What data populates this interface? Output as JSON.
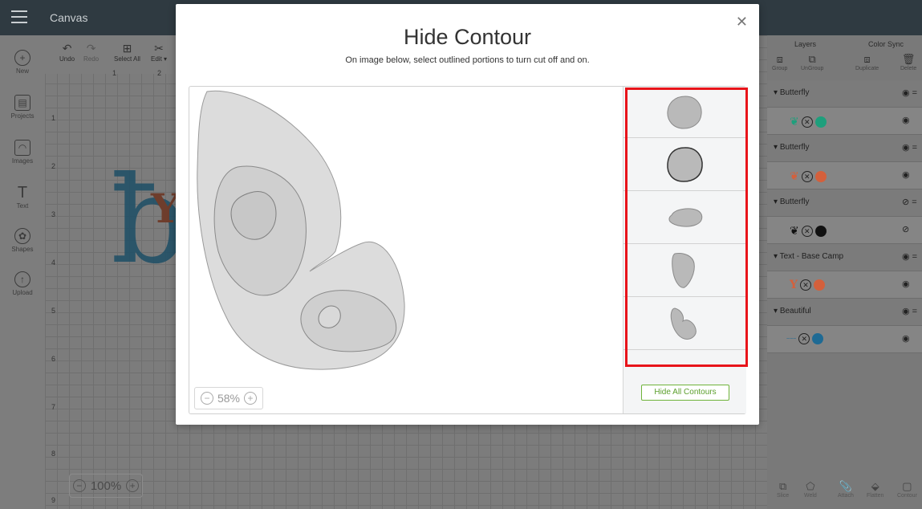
{
  "app": {
    "title": "Canvas"
  },
  "toolbar": {
    "undo": "Undo",
    "redo": "Redo",
    "select_all": "Select All",
    "edit": "Edit ▾"
  },
  "left_rail": [
    {
      "label": "New",
      "icon": "plus-icon"
    },
    {
      "label": "Projects",
      "icon": "projects-icon"
    },
    {
      "label": "Images",
      "icon": "images-icon"
    },
    {
      "label": "Text",
      "icon": "text-icon"
    },
    {
      "label": "Shapes",
      "icon": "shapes-icon"
    },
    {
      "label": "Upload",
      "icon": "upload-icon"
    }
  ],
  "ruler": {
    "horizontal": [
      "1",
      "2"
    ],
    "vertical": [
      "1",
      "2",
      "3",
      "4",
      "5",
      "6",
      "7",
      "8",
      "9"
    ]
  },
  "canvas": {
    "zoom": "100%"
  },
  "right_panel": {
    "tabs": [
      "Layers",
      "Color Sync"
    ],
    "tools": [
      "Group",
      "UnGroup",
      "Duplicate",
      "Delete"
    ],
    "layers": [
      {
        "label": "Butterfly",
        "kind": "group",
        "eye": "visible"
      },
      {
        "label": "",
        "kind": "item",
        "color": "#1e9f7c",
        "eye": "visible"
      },
      {
        "label": "Butterfly",
        "kind": "group",
        "eye": "visible"
      },
      {
        "label": "",
        "kind": "item",
        "color": "#d4603c",
        "eye": "visible"
      },
      {
        "label": "Butterfly",
        "kind": "group",
        "eye": "hidden"
      },
      {
        "label": "",
        "kind": "item",
        "color": "#111111",
        "eye": "hidden"
      },
      {
        "label": "Text - Base Camp",
        "kind": "group",
        "eye": "visible"
      },
      {
        "label": "",
        "kind": "item",
        "color": "#d4603c",
        "eye": "visible"
      },
      {
        "label": "Beautiful",
        "kind": "group",
        "eye": "visible"
      },
      {
        "label": "",
        "kind": "item",
        "color": "#1e6a94",
        "eye": "visible"
      }
    ],
    "bottom_tools": [
      "Slice",
      "Weld",
      "Attach",
      "Flatten",
      "Contour"
    ]
  },
  "modal": {
    "title": "Hide Contour",
    "subtitle": "On image below, select outlined portions to turn cut off and on.",
    "zoom": "58%",
    "hide_all_label": "Hide All Contours",
    "contours": [
      {
        "name": "contour-1",
        "shape": "blob-round"
      },
      {
        "name": "contour-2",
        "shape": "blob-round-outlined"
      },
      {
        "name": "contour-3",
        "shape": "oval"
      },
      {
        "name": "contour-4",
        "shape": "teardrop"
      },
      {
        "name": "contour-5",
        "shape": "wing-small"
      }
    ]
  }
}
